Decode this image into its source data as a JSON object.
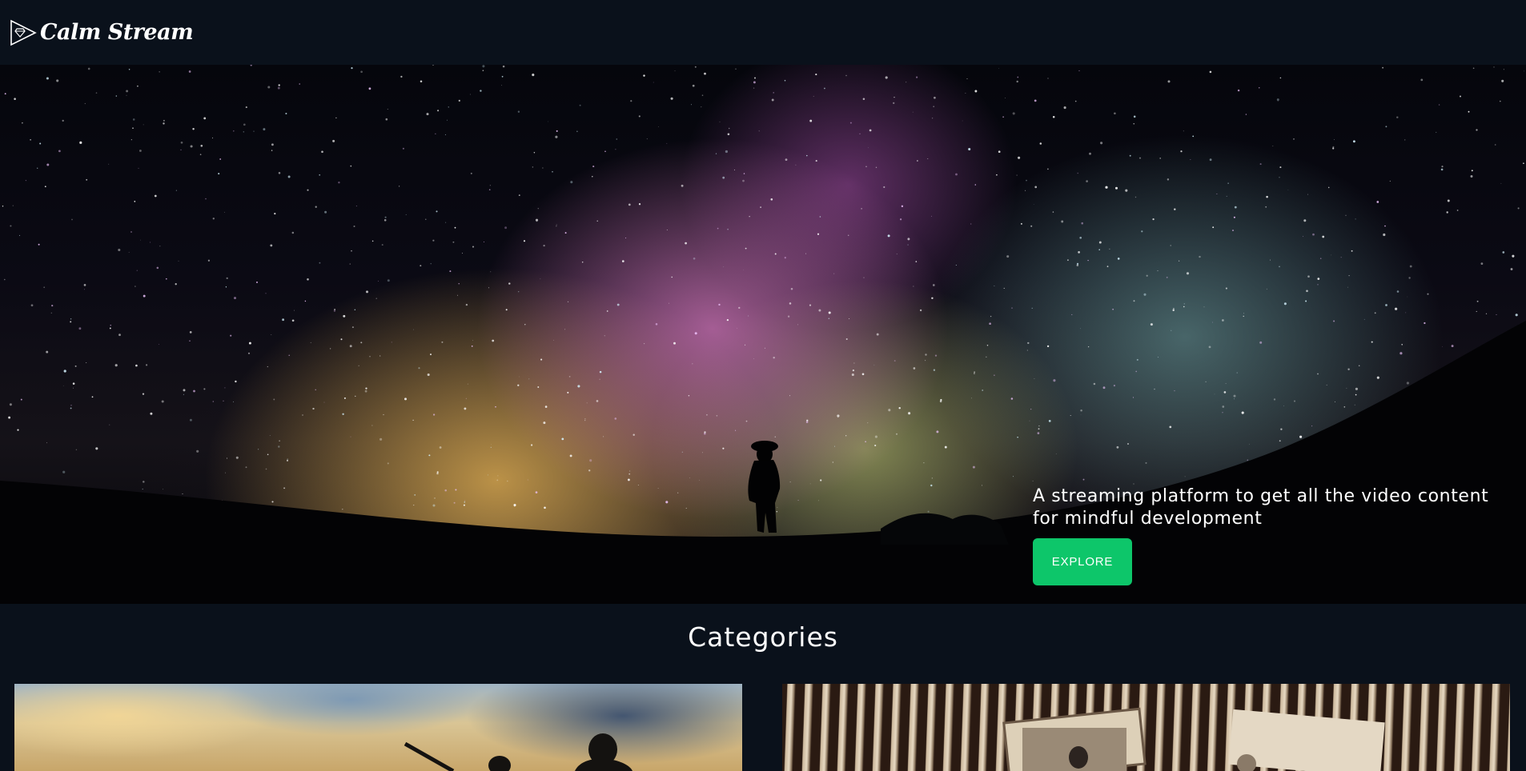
{
  "header": {
    "brand_name": "Calm Stream",
    "logo_icon": "play-triangle-diamond-icon"
  },
  "hero": {
    "tagline": "A streaming platform to get all the video content for mindful development",
    "explore_label": "EXPLORE",
    "accent_color": "#0dc66a",
    "background_image": "night-sky-milky-way-silhouette"
  },
  "categories": {
    "title": "Categories",
    "cards": [
      {
        "image": "sunset-sky-silhouettes"
      },
      {
        "image": "vintage-photographs-box"
      }
    ]
  }
}
